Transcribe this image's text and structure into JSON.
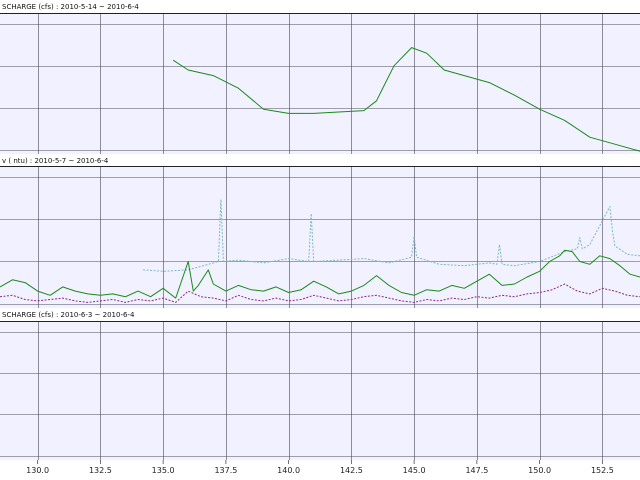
{
  "colors": {
    "plot_background": "#f1f1ff",
    "grid": "#4a4a5a",
    "header_background": "#ffffff",
    "divider": "#222222",
    "series_green": "#1a8a1a",
    "series_purple": "#8a2a8a",
    "series_cyan": "#7ab8c8"
  },
  "x_axis": {
    "range": [
      128.5,
      154.0
    ],
    "grid": [
      130.0,
      132.5,
      135.0,
      137.5,
      140.0,
      142.5,
      145.0,
      147.5,
      150.0,
      152.5
    ],
    "ticks": [
      "130.0",
      "132.5",
      "135.0",
      "137.5",
      "140.0",
      "142.5",
      "145.0",
      "147.5",
      "150.0",
      "152.5"
    ]
  },
  "chart_data": [
    {
      "type": "line",
      "title": "SCHARGE (cfs) : 2010-5-14 ~ 2010-6-4",
      "grid": true,
      "ylim": [
        0,
        100
      ],
      "series": [
        {
          "color": "#1a8a1a",
          "x": [
            135.4,
            136.0,
            137.0,
            138.0,
            139.0,
            140.0,
            141.0,
            142.0,
            143.0,
            143.5,
            144.2,
            144.9,
            145.5,
            146.2,
            147.0,
            148.0,
            149.0,
            150.0,
            151.0,
            152.0,
            153.0,
            154.0
          ],
          "y": [
            67,
            60,
            56,
            47,
            32,
            29,
            29,
            30,
            31,
            38,
            63,
            76,
            72,
            60,
            56,
            51,
            42,
            32,
            24,
            12,
            7,
            2
          ]
        }
      ]
    },
    {
      "type": "line",
      "title": "v ( ntu) : 2010-5-7 ~ 2010-6-4",
      "grid": true,
      "ylim": [
        0,
        100
      ],
      "series": [
        {
          "color": "#7ab8c8",
          "x": [
            134.2,
            135.0,
            136.0,
            137.2,
            137.3,
            137.4,
            138.0,
            139.0,
            140.0,
            140.8,
            140.9,
            141.0,
            142.0,
            143.0,
            144.0,
            144.9,
            145.0,
            145.1,
            146.0,
            147.0,
            148.0,
            148.3,
            148.4,
            148.5,
            149.0,
            150.0,
            151.0,
            151.5,
            151.6,
            151.7,
            152.0,
            152.8,
            152.9,
            153.0,
            153.5,
            154.0
          ],
          "y": [
            27,
            26,
            27,
            33,
            77,
            33,
            34,
            32,
            35,
            33,
            67,
            33,
            34,
            35,
            32,
            36,
            51,
            36,
            31,
            30,
            32,
            31,
            45,
            31,
            30,
            33,
            40,
            42,
            50,
            42,
            45,
            72,
            55,
            44,
            38,
            37
          ]
        },
        {
          "color": "#1a8a1a",
          "x": [
            128.5,
            129.0,
            129.5,
            130.0,
            130.5,
            131.0,
            131.5,
            132.0,
            132.5,
            133.0,
            133.5,
            134.0,
            134.5,
            135.0,
            135.5,
            136.0,
            136.2,
            136.4,
            136.8,
            137.0,
            137.5,
            138.0,
            138.5,
            139.0,
            139.5,
            140.0,
            140.5,
            141.0,
            141.5,
            142.0,
            142.5,
            143.0,
            143.5,
            144.0,
            144.5,
            145.0,
            145.5,
            146.0,
            146.5,
            147.0,
            147.5,
            148.0,
            148.5,
            149.0,
            149.5,
            150.0,
            150.4,
            150.8,
            151.0,
            151.3,
            151.6,
            152.0,
            152.4,
            152.8,
            153.2,
            153.6,
            154.0
          ],
          "y": [
            15,
            20,
            18,
            12,
            9,
            15,
            12,
            10,
            9,
            10,
            8,
            12,
            8,
            14,
            7,
            33,
            12,
            16,
            27,
            17,
            12,
            16,
            13,
            12,
            15,
            11,
            13,
            19,
            15,
            10,
            12,
            16,
            23,
            16,
            11,
            9,
            13,
            12,
            16,
            14,
            19,
            24,
            16,
            17,
            22,
            26,
            33,
            37,
            41,
            40,
            33,
            31,
            37,
            35,
            30,
            24,
            22
          ]
        },
        {
          "color": "#8a2a8a",
          "x": [
            128.5,
            129.0,
            129.5,
            130.0,
            130.5,
            131.0,
            131.5,
            132.0,
            132.5,
            133.0,
            133.5,
            134.0,
            134.5,
            135.0,
            135.5,
            136.0,
            136.5,
            137.0,
            137.5,
            138.0,
            138.5,
            139.0,
            139.5,
            140.0,
            140.5,
            141.0,
            141.5,
            142.0,
            142.5,
            143.0,
            143.5,
            144.0,
            144.5,
            145.0,
            145.5,
            146.0,
            146.5,
            147.0,
            147.5,
            148.0,
            148.5,
            149.0,
            149.5,
            150.0,
            150.5,
            151.0,
            151.5,
            152.0,
            152.5,
            153.0,
            153.5,
            154.0
          ],
          "y": [
            8,
            9,
            6,
            5,
            6,
            7,
            5,
            4,
            5,
            6,
            4,
            6,
            5,
            7,
            4,
            12,
            8,
            7,
            5,
            9,
            6,
            5,
            7,
            5,
            6,
            9,
            7,
            5,
            6,
            8,
            9,
            7,
            5,
            4,
            6,
            5,
            7,
            6,
            8,
            7,
            9,
            8,
            10,
            11,
            13,
            17,
            12,
            10,
            14,
            12,
            9,
            8
          ]
        }
      ]
    },
    {
      "type": "line",
      "title": "SCHARGE (cfs) : 2010-6-3 ~ 2010-6-4",
      "grid": true,
      "ylim": [
        0,
        100
      ],
      "series": []
    }
  ]
}
